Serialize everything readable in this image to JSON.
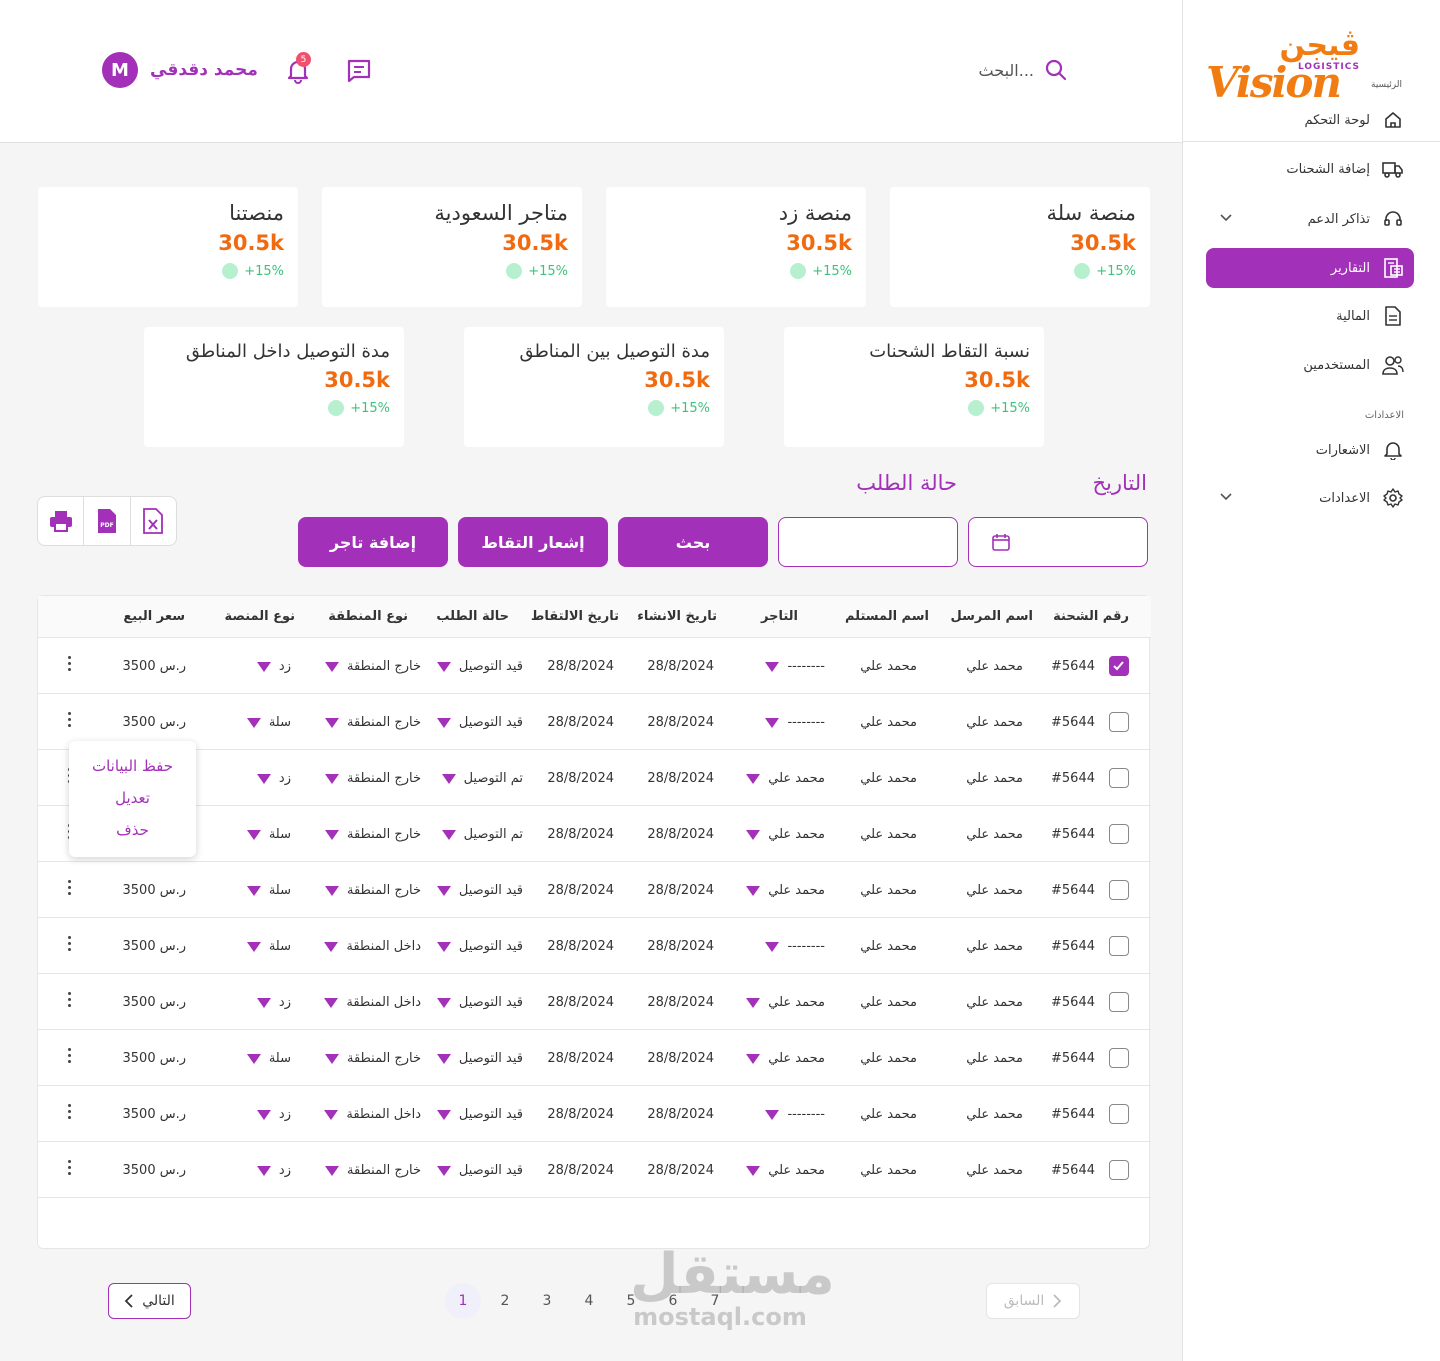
{
  "brand": {
    "logo_ar": "ڤيجن",
    "logo_en": "Vision",
    "logo_sub": "LOGISTICS",
    "breadcrumb": "الرئيسية"
  },
  "sidebar": {
    "items": [
      {
        "label": "لوحة التحكم"
      },
      {
        "label": "إضافة الشحنات"
      },
      {
        "label": "تذاكر الدعم"
      },
      {
        "label": "التقارير"
      },
      {
        "label": "المالية"
      },
      {
        "label": "المستخدمين"
      }
    ],
    "section_label": "الاعدادات",
    "settings_items": [
      {
        "label": "الاشعارات"
      },
      {
        "label": "الاعدادات"
      }
    ]
  },
  "header": {
    "search_placeholder": "البحث...",
    "user_name": "محمد دقدقي",
    "avatar_letter": "M",
    "notification_count": "5"
  },
  "stats": [
    {
      "title": "منصة سلة",
      "value": "30.5k",
      "change": "+15%"
    },
    {
      "title": "منصة زد",
      "value": "30.5k",
      "change": "+15%"
    },
    {
      "title": "متاجر السعودية",
      "value": "30.5k",
      "change": "+15%"
    },
    {
      "title": "منصتنا",
      "value": "30.5k",
      "change": "+15%"
    },
    {
      "title": "نسبة التقاط الشحنات",
      "value": "30.5k",
      "change": "+15%"
    },
    {
      "title": "مدة التوصيل بين المناطق",
      "value": "30.5k",
      "change": "+15%"
    },
    {
      "title": "مدة التوصيل داخل المناطق",
      "value": "30.5k",
      "change": "+15%"
    }
  ],
  "filters": {
    "date_label": "التاريخ",
    "status_label": "حالة الطلب",
    "search_button": "بحث",
    "pickup_notice_button": "إشعار التقاط",
    "add_merchant_button": "إضافة تاجر"
  },
  "table": {
    "columns": [
      "رقم الشحنة",
      "اسم المرسل",
      "اسم المستلم",
      "التاجر",
      "تاريخ الانشاء",
      "تاريخ الالتقاط",
      "حالة الطلب",
      "نوع المنطقة",
      "نوع المنصة",
      "سعر البيع"
    ],
    "rows": [
      {
        "checked": true,
        "id": "#5644",
        "sender": "محمد علي",
        "receiver": "محمد علي",
        "merchant": "--------",
        "created": "28/8/2024",
        "pickup": "28/8/2024",
        "status": "قيد التوصيل",
        "zone": "خارج المنطقة",
        "platform": "زد",
        "price": "3500 ر.س"
      },
      {
        "checked": false,
        "id": "#5644",
        "sender": "محمد علي",
        "receiver": "محمد علي",
        "merchant": "--------",
        "created": "28/8/2024",
        "pickup": "28/8/2024",
        "status": "قيد التوصيل",
        "zone": "خارج المنطقة",
        "platform": "سلة",
        "price": "3500 ر.س"
      },
      {
        "checked": false,
        "id": "#5644",
        "sender": "محمد علي",
        "receiver": "محمد علي",
        "merchant": "محمد علي",
        "created": "28/8/2024",
        "pickup": "28/8/2024",
        "status": "تم التوصيل",
        "zone": "خارج المنطقة",
        "platform": "زد",
        "price": ""
      },
      {
        "checked": false,
        "id": "#5644",
        "sender": "محمد علي",
        "receiver": "محمد علي",
        "merchant": "محمد علي",
        "created": "28/8/2024",
        "pickup": "28/8/2024",
        "status": "تم التوصيل",
        "zone": "خارج المنطقة",
        "platform": "سلة",
        "price": ""
      },
      {
        "checked": false,
        "id": "#5644",
        "sender": "محمد علي",
        "receiver": "محمد علي",
        "merchant": "محمد علي",
        "created": "28/8/2024",
        "pickup": "28/8/2024",
        "status": "قيد التوصيل",
        "zone": "خارج المنطقة",
        "platform": "سلة",
        "price": "3500 ر.س"
      },
      {
        "checked": false,
        "id": "#5644",
        "sender": "محمد علي",
        "receiver": "محمد علي",
        "merchant": "--------",
        "created": "28/8/2024",
        "pickup": "28/8/2024",
        "status": "قيد التوصيل",
        "zone": "داخل المنطقة",
        "platform": "سلة",
        "price": "3500 ر.س"
      },
      {
        "checked": false,
        "id": "#5644",
        "sender": "محمد علي",
        "receiver": "محمد علي",
        "merchant": "محمد علي",
        "created": "28/8/2024",
        "pickup": "28/8/2024",
        "status": "قيد التوصيل",
        "zone": "داخل المنطقة",
        "platform": "زد",
        "price": "3500 ر.س"
      },
      {
        "checked": false,
        "id": "#5644",
        "sender": "محمد علي",
        "receiver": "محمد علي",
        "merchant": "محمد علي",
        "created": "28/8/2024",
        "pickup": "28/8/2024",
        "status": "قيد التوصيل",
        "zone": "خارج المنطقة",
        "platform": "سلة",
        "price": "3500 ر.س"
      },
      {
        "checked": false,
        "id": "#5644",
        "sender": "محمد علي",
        "receiver": "محمد علي",
        "merchant": "--------",
        "created": "28/8/2024",
        "pickup": "28/8/2024",
        "status": "قيد التوصيل",
        "zone": "داخل المنطقة",
        "platform": "زد",
        "price": "3500 ر.س"
      },
      {
        "checked": false,
        "id": "#5644",
        "sender": "محمد علي",
        "receiver": "محمد علي",
        "merchant": "محمد علي",
        "created": "28/8/2024",
        "pickup": "28/8/2024",
        "status": "قيد التوصيل",
        "zone": "خارج المنطقة",
        "platform": "زد",
        "price": "3500 ر.س"
      }
    ],
    "row_menu": [
      "حفظ البيانات",
      "تعديل",
      "حذف"
    ]
  },
  "pagination": {
    "next_label": "التالي",
    "prev_label": "السابق",
    "pages": [
      "1",
      "2",
      "3",
      "4",
      "5",
      "6",
      "7"
    ],
    "current": "1"
  },
  "watermark": {
    "ar": "مستقل",
    "en": "mostaql.com"
  },
  "colors": {
    "primary": "#a230b8",
    "value": "#f06a10",
    "positive": "#3cc37a"
  }
}
